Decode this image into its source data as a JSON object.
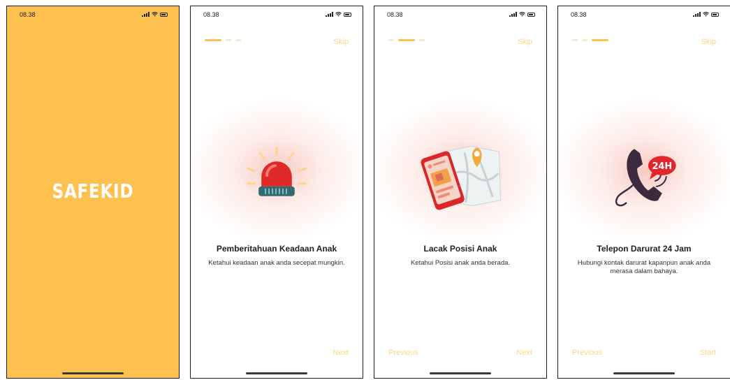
{
  "status_time": "08.38",
  "splash": {
    "logo_text": "SAFEKID",
    "background_color": "#FEC14F"
  },
  "accent_color": "#FEC14F",
  "onboarding": [
    {
      "step": 1,
      "skip_label": "Skip",
      "illustration": "alarm-siren-icon",
      "title": "Pemberitahuan Keadaan Anak",
      "description": "Ketahui keadaan anak anda secepat mungkin.",
      "next_label": "Next"
    },
    {
      "step": 2,
      "skip_label": "Skip",
      "illustration": "phone-map-location-icon",
      "title": "Lacak Posisi Anak",
      "description": "Ketahui Posisi anak anda berada.",
      "previous_label": "Previous",
      "next_label": "Next"
    },
    {
      "step": 3,
      "skip_label": "Skip",
      "illustration": "telephone-24h-icon",
      "badge_text": "24H",
      "title": "Telepon Darurat 24 Jam",
      "description": "Hubungi kontak darurat kapanpun anak anda merasa dalam bahaya.",
      "previous_label": "Previous",
      "start_label": "Start"
    }
  ]
}
